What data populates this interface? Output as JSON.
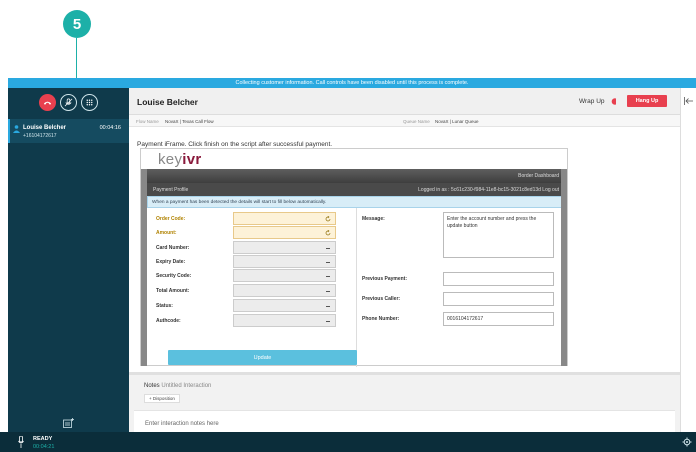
{
  "step_number": "5",
  "banner": "Collecting customer information. Call controls have been disabled until this process is complete.",
  "sidebar": {
    "controls": [
      "hangup-phone-icon",
      "mute-icon",
      "keypad-icon"
    ],
    "contact": {
      "name": "Louise Belcher",
      "phone": "+16104172617",
      "time": "00:04:16"
    }
  },
  "status": {
    "label": "READY",
    "time": "00:04:21"
  },
  "header": {
    "title": "Louise Belcher",
    "wrap_up": "Wrap Up",
    "hang_up": "Hang Up",
    "flow_label": "Flow Name",
    "flow_value": "NovaX | Texas Call Flow",
    "queue_label": "Queue Name",
    "queue_value": "NovaX | Lunar Queue"
  },
  "payment": {
    "instruction": "Payment iFrame. Click finish on the script after successful payment.",
    "logo_a": "key",
    "logo_b": "ivr",
    "dashboard": "Border Dashboard",
    "nav": "Payment  Profile",
    "logged_in": "Logged in as : 5c61c230-f984-11e8-bc15-3021c8ed13d   Log out",
    "notice": "When a payment has been detected the details will start to fill below automatically.",
    "fields": [
      {
        "label": "Order Code:",
        "warn": true
      },
      {
        "label": "Amount:",
        "warn": true
      },
      {
        "label": "Card Number:",
        "warn": false
      },
      {
        "label": "Expiry Date:",
        "warn": false
      },
      {
        "label": "Security Code:",
        "warn": false
      },
      {
        "label": "Total Amount:",
        "warn": false
      },
      {
        "label": "Status:",
        "warn": false
      },
      {
        "label": "Authcode:",
        "warn": false
      }
    ],
    "update": "Update",
    "message_label": "Message:",
    "message_value": "Enter the account number and press the update button",
    "prev_payment_label": "Previous Payment:",
    "prev_caller_label": "Previous Caller:",
    "phone_label": "Phone Number:",
    "phone_value": "0016104172617"
  },
  "notes": {
    "label": "Notes",
    "subtitle": "Untitled Interaction",
    "disposition": "+  Disposition",
    "placeholder": "Enter interaction notes here"
  }
}
